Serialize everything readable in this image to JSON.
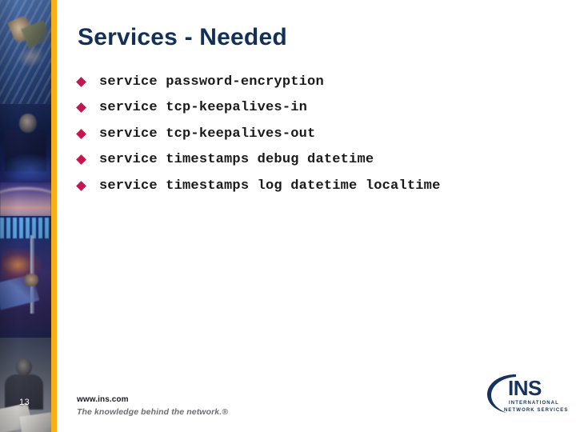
{
  "slide": {
    "title": "Services - Needed",
    "page_number": "13",
    "title_color": "#123058",
    "accent_bar_color": "#FBAF17",
    "bullet_color": "#C8144F"
  },
  "bullets": [
    {
      "marker": "diamond-bullet",
      "text": "service password-encryption"
    },
    {
      "marker": "diamond-bullet",
      "text": "service tcp-keepalives-in"
    },
    {
      "marker": "diamond-bullet",
      "text": "service tcp-keepalives-out"
    },
    {
      "marker": "diamond-bullet",
      "text": "service timestamps debug datetime"
    },
    {
      "marker": "diamond-bullet",
      "text": "service timestamps log datetime localtime"
    }
  ],
  "footer": {
    "url": "www.ins.com",
    "tagline": "The knowledge behind the network.®"
  },
  "logo": {
    "wordmark": "INS",
    "line1": "INTERNATIONAL",
    "line2": "NETWORK SERVICES",
    "color": "#17335C"
  }
}
